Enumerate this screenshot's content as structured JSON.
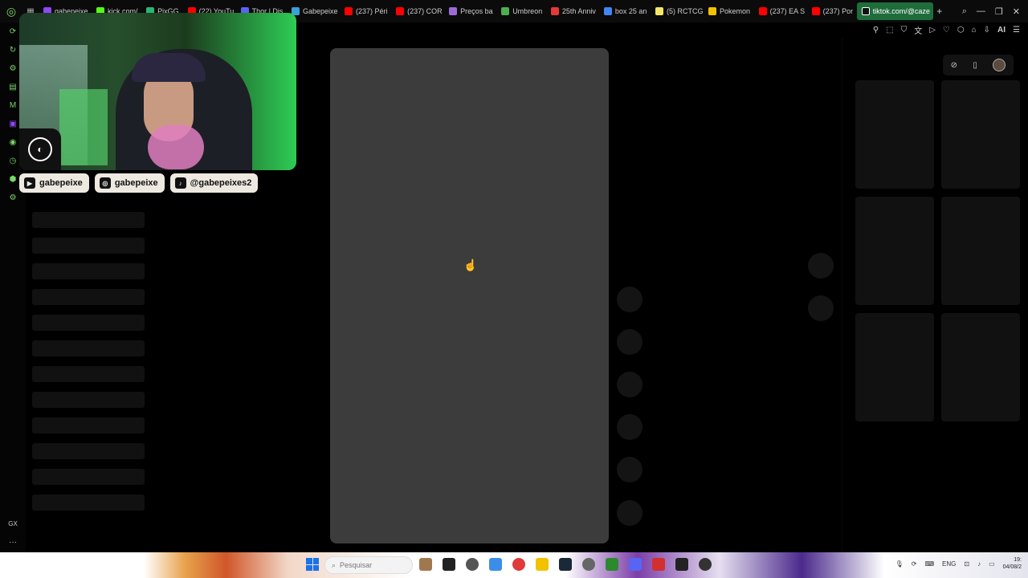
{
  "tabs": [
    {
      "label": "gabepeixe",
      "color": "#9146ff"
    },
    {
      "label": "kick.com/",
      "color": "#53fc18"
    },
    {
      "label": "PixGG",
      "color": "#2bb673"
    },
    {
      "label": "(22) YouTu",
      "color": "#ff0000"
    },
    {
      "label": "Thor | Dis",
      "color": "#5865f2"
    },
    {
      "label": "Gabepeixe",
      "color": "#3aa0d8"
    },
    {
      "label": "(237) Péri",
      "color": "#ff0000"
    },
    {
      "label": "(237) COR",
      "color": "#ff0000"
    },
    {
      "label": "Preços ba",
      "color": "#9c6ad8"
    },
    {
      "label": "Umbreon",
      "color": "#4caf50"
    },
    {
      "label": "25th Anniv",
      "color": "#e53935"
    },
    {
      "label": "box 25 an",
      "color": "#4285f4"
    },
    {
      "label": "(5) RCTCG",
      "color": "#f5e663"
    },
    {
      "label": "Pokemon",
      "color": "#f2c200"
    },
    {
      "label": "(237) EA S",
      "color": "#ff0000"
    },
    {
      "label": "(237) Por",
      "color": "#ff0000"
    }
  ],
  "active_tab": {
    "label": "tiktok.com/@caze"
  },
  "window_controls": {
    "search": "⌕",
    "minimize": "—",
    "restore": "❐",
    "close": "✕"
  },
  "toolbar_icons": [
    "pin-icon",
    "screenshot-icon",
    "shield-icon",
    "translate-icon",
    "play-icon",
    "heart-icon",
    "extensions-icon",
    "wallet-icon",
    "download-icon",
    "ai-icon",
    "menu-icon"
  ],
  "toolbar_ai_label": "AI",
  "socials": [
    {
      "icon": "youtube-icon",
      "label": "gabepeixe"
    },
    {
      "icon": "instagram-icon",
      "label": "gabepeixe"
    },
    {
      "icon": "tiktok-icon",
      "label": "@gabepeixes2"
    }
  ],
  "gx_footer": "GX",
  "gx_more": "···",
  "taskbar": {
    "search_placeholder": "Pesquisar",
    "tray_lang": "ENG",
    "time": "19:",
    "date": "04/08/2"
  },
  "colors": {
    "accent": "#7bd56a",
    "active_tab": "#1f6d3b",
    "video_placeholder": "#3c3c3c"
  }
}
